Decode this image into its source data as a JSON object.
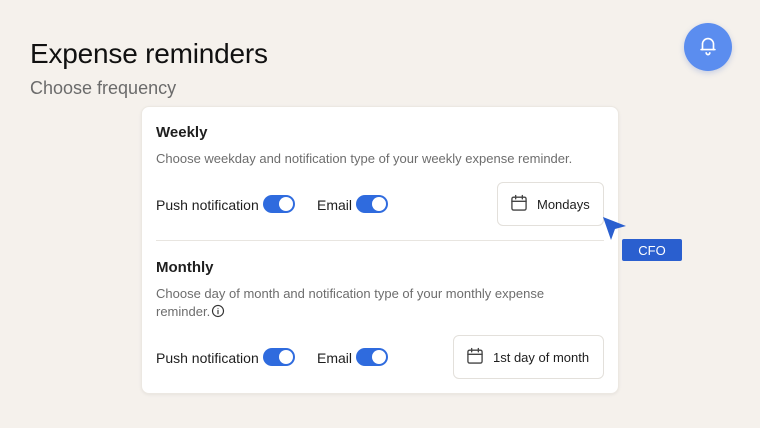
{
  "header": {
    "title": "Expense reminders",
    "subtitle": "Choose frequency"
  },
  "icons": {
    "bell": "bell-icon",
    "calendar": "calendar-icon",
    "info": "info-icon",
    "cursor": "cursor-pointer-icon"
  },
  "colors": {
    "accent": "#2f6bde",
    "bell_button": "#5b8def",
    "background": "#f5f1ec"
  },
  "weekly": {
    "title": "Weekly",
    "description": "Choose weekday and notification type of your weekly expense reminder.",
    "push_label": "Push notification",
    "push_on": true,
    "email_label": "Email",
    "email_on": true,
    "day_value": "Mondays"
  },
  "monthly": {
    "title": "Monthly",
    "description": "Choose day of month and notification type of your monthly expense reminder.",
    "push_label": "Push notification",
    "push_on": true,
    "email_label": "Email",
    "email_on": true,
    "day_value": "1st day of month"
  },
  "cursor_tag": "CFO"
}
